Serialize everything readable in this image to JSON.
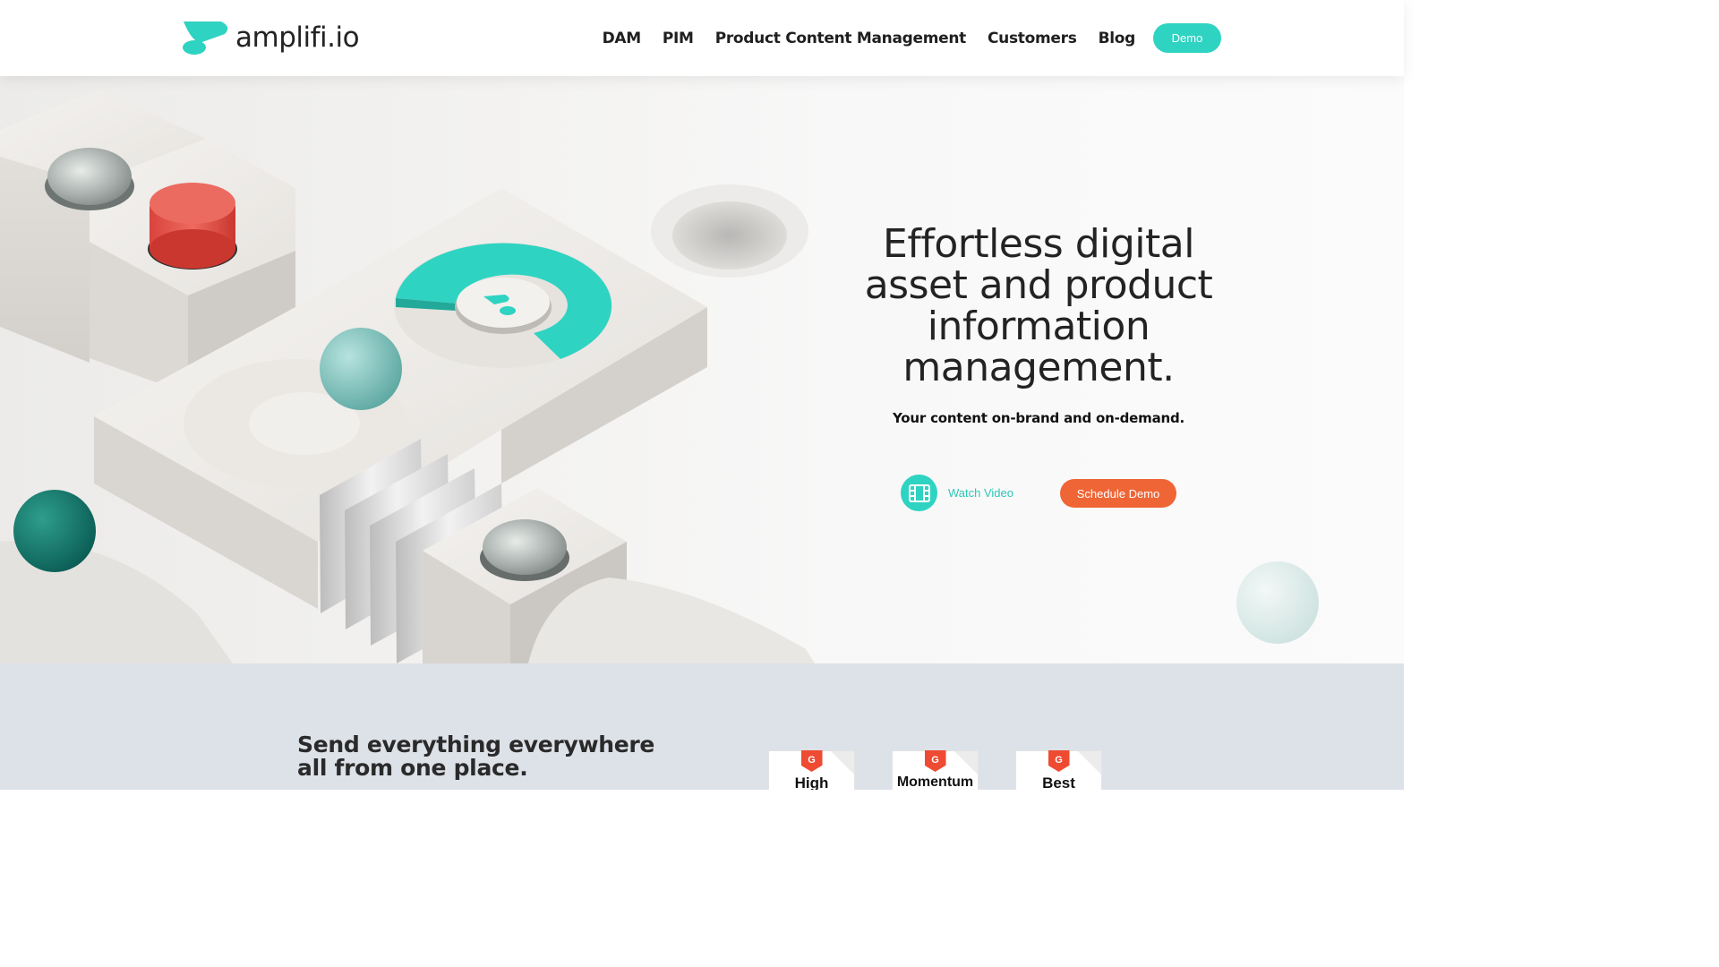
{
  "brand": {
    "name": "amplifi.io",
    "accent": "#2fd3c2",
    "cta": "#ef6536"
  },
  "nav": {
    "items": [
      {
        "label": "DAM"
      },
      {
        "label": "PIM"
      },
      {
        "label": "Product Content Management"
      },
      {
        "label": "Customers"
      },
      {
        "label": "Blog"
      }
    ],
    "demo_label": "Demo"
  },
  "hero": {
    "title": "Effortless digital asset and product information management.",
    "subtitle": "Your content on-brand and on-demand.",
    "watch_label": "Watch Video",
    "watch_icon": "film-icon",
    "schedule_label": "Schedule Demo"
  },
  "lower": {
    "title": "Send everything everywhere all from one place.",
    "badges": [
      {
        "mark": "G",
        "label": "High"
      },
      {
        "mark": "G",
        "label": "Momentum"
      },
      {
        "mark": "G",
        "label": "Best"
      }
    ]
  }
}
